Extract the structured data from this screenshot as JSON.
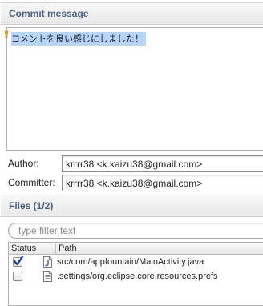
{
  "commit_section": {
    "title": "Commit message",
    "message": "コメントを良い感じにしました！"
  },
  "author": {
    "label": "Author:",
    "value": "krrrr38 <k.kaizu38@gmail.com>"
  },
  "committer": {
    "label": "Committer:",
    "value": "krrrr38 <k.kaizu38@gmail.com>"
  },
  "files_section": {
    "title": "Files (1/2)",
    "filter_placeholder": "type filter text",
    "columns": [
      "Status",
      "Path"
    ],
    "rows": [
      {
        "checked": true,
        "icon": "java-file-icon",
        "path": "src/com/appfountain/MainActivity.java"
      },
      {
        "checked": false,
        "icon": "text-file-icon",
        "path": ".settings/org.eclipse.core.resources.prefs"
      }
    ]
  },
  "colors": {
    "section_title": "#4b6282",
    "selection": "#b5d5ff",
    "checkmark": "#1c3f8f"
  }
}
